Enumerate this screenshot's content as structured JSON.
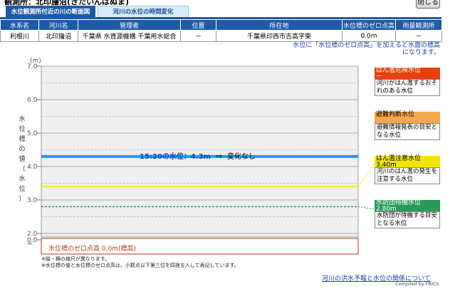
{
  "header": {
    "title": "観測所：北印旛沼(きたいんばぬま)",
    "close_label": "閉じる",
    "tabs": [
      {
        "label": "水位観測所付近の川の断面図",
        "active": true
      },
      {
        "label": "河川の水位の時間変化",
        "active": false
      }
    ]
  },
  "info_table": {
    "headers": [
      "水系名",
      "河川名",
      "管理者",
      "位置",
      "所在地",
      "水位標のゼロ点高",
      "雨量観測所"
    ],
    "row": [
      "利根川",
      "北印旛沼",
      "千葉県 水資源機構 千葉用水総合",
      "－",
      "千葉県印西市吉高字東",
      "0.0m",
      "－"
    ]
  },
  "note_right": [
    "水位に「水位標のゼロ点高」を加えると水面の標高",
    "になります。"
  ],
  "chart": {
    "unit": "(m)",
    "ylabel": "水位標の値（水位）",
    "break_symbol": "≈",
    "current_label": "15:20の水位：4.3m",
    "change_label": "変化なし",
    "zero_label": "水位標のゼロ点高 0.0m(標高)"
  },
  "chart_data": {
    "type": "line",
    "y_ticks": [
      "7.0",
      "6.0",
      "5.0",
      "4.0",
      "3.0",
      "2.0",
      "0.0"
    ],
    "ylim": [
      2.0,
      7.0
    ],
    "current_level": 4.3,
    "current_time": "15:20",
    "trend": "変化なし",
    "thresholds": [
      {
        "name": "はん濫危険水位",
        "value_text": "－",
        "value": null,
        "color": "#e8400a"
      },
      {
        "name": "避難判断水位",
        "value_text": "－",
        "value": null,
        "color": "#f5a84a"
      },
      {
        "name": "はん濫注意水位",
        "value_text": "3.40m",
        "value": 3.4,
        "color": "#f2e600"
      },
      {
        "name": "水防団待機水位",
        "value_text": "2.80m",
        "value": 2.8,
        "color": "#2a9a5a"
      }
    ]
  },
  "legend": [
    {
      "title": "はん濫危険水位",
      "value": "－",
      "desc": "河川がはん濫するおそれのある水位",
      "bg": "#e8400a",
      "fg": "#ffffff"
    },
    {
      "title": "避難判断水位",
      "value": "",
      "desc": "避難情報発表の目安となる水位",
      "bg": "#f5a84a",
      "fg": "#000000"
    },
    {
      "title": "はん濫注意水位",
      "value": "3.40m",
      "desc": "河川のはん濫の発生を注意する水位",
      "bg": "#f2e600",
      "fg": "#000000"
    },
    {
      "title": "水防団待機水位",
      "value": "2.80m",
      "desc": "水防団が待機する目安となる水位",
      "bg": "#2a9a5a",
      "fg": "#ffffff"
    }
  ],
  "footnotes": [
    "※縦・横の縮尺が異なります。",
    "※水位標の値と水位標のゼロ点高は、小数点以下第三位を四捨五入して表記しています。"
  ],
  "links": {
    "relation": "河川の洪水予報と水位の関係について"
  },
  "credit": "Compiled by FRICS"
}
